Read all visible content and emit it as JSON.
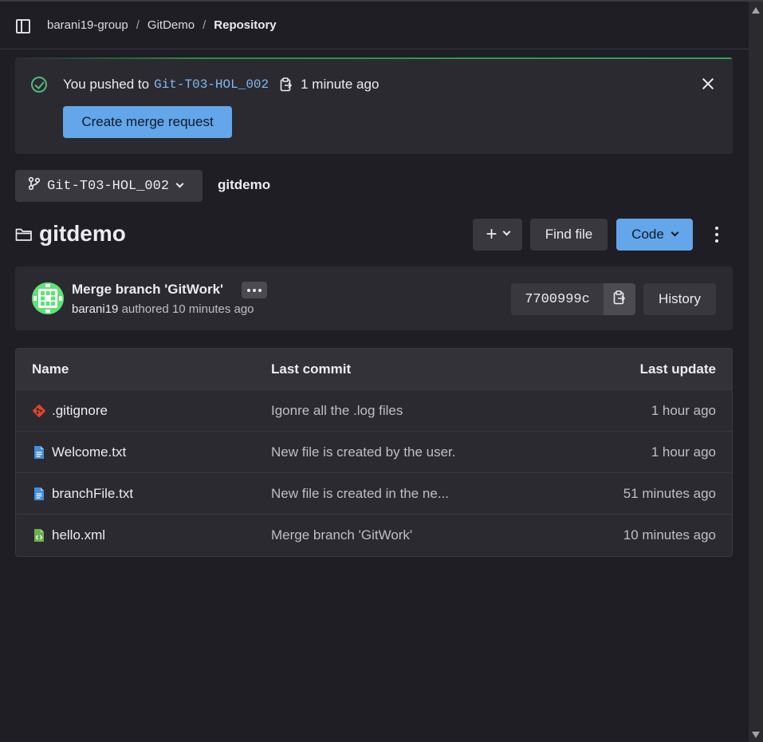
{
  "header": {
    "breadcrumb": [
      "barani19-group",
      "GitDemo",
      "Repository"
    ]
  },
  "alert": {
    "prefix": "You pushed to",
    "branch": "Git-T03-HOL_002",
    "time": "1 minute ago",
    "button_label": "Create merge request"
  },
  "branch_selector": {
    "value": "Git-T03-HOL_002"
  },
  "path": "gitdemo",
  "repo": {
    "title": "gitdemo",
    "add_symbol": "+",
    "find_file_label": "Find file",
    "code_label": "Code"
  },
  "commit": {
    "title": "Merge branch 'GitWork'",
    "author": "barani19",
    "authored_text": "authored",
    "time": "10 minutes ago",
    "sha": "7700999c",
    "history_label": "History"
  },
  "table": {
    "headers": [
      "Name",
      "Last commit",
      "Last update"
    ],
    "rows": [
      {
        "icon": "gitignore-icon",
        "name": ".gitignore",
        "commit": "Igonre all the .log files",
        "updated": "1 hour ago"
      },
      {
        "icon": "text-file-icon",
        "name": "Welcome.txt",
        "commit": "New file is created by the user.",
        "updated": "1 hour ago"
      },
      {
        "icon": "text-file-icon",
        "name": "branchFile.txt",
        "commit": "New file is created in the ne...",
        "updated": "51 minutes ago"
      },
      {
        "icon": "xml-file-icon",
        "name": "hello.xml",
        "commit": "Merge branch 'GitWork'",
        "updated": "10 minutes ago"
      }
    ]
  },
  "colors": {
    "background": "#1f1e24",
    "card": "#2b2a30",
    "button": "#3a383f",
    "primary": "#63a6e9",
    "success": "#52b87a",
    "link": "#81b8f5",
    "avatar": "#5fe176"
  }
}
